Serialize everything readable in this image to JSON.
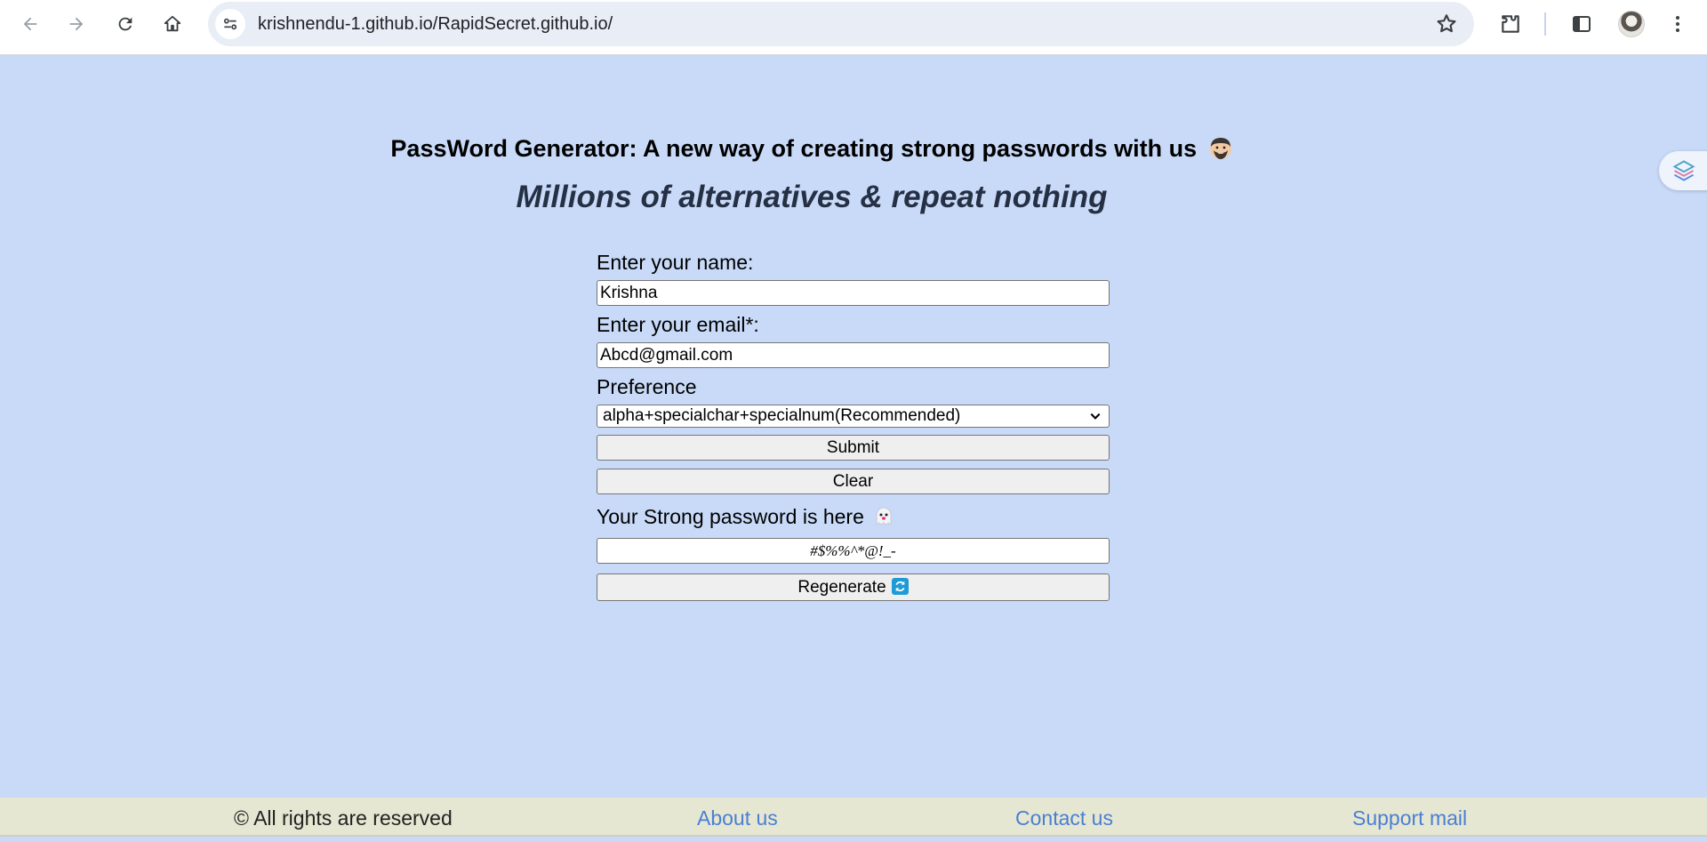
{
  "browser": {
    "url": "krishnendu-1.github.io/RapidSecret.github.io/"
  },
  "page": {
    "title": "PassWord Generator: A new way of creating strong passwords with us",
    "subtitle": "Millions of alternatives & repeat nothing"
  },
  "form": {
    "name_label": "Enter your name:",
    "name_value": "Krishna",
    "email_label": "Enter your email*:",
    "email_value": "Abcd@gmail.com",
    "preference_label": "Preference",
    "preference_selected": "alpha+specialchar+specialnum(Recommended)",
    "submit_label": "Submit",
    "clear_label": "Clear",
    "result_label": "Your Strong password is here",
    "password_value": "#$%%^*@!_-",
    "regenerate_label": "Regenerate"
  },
  "footer": {
    "copyright": "© All rights are reserved",
    "about": "About us",
    "contact": "Contact us",
    "support": "Support mail"
  },
  "icons": {
    "back": "back-arrow-icon",
    "forward": "forward-arrow-icon",
    "reload": "reload-icon",
    "home": "home-icon",
    "site_info": "site-settings-icon",
    "bookmark": "star-icon",
    "extensions": "puzzle-icon",
    "side_panel": "side-panel-icon",
    "menu": "kebab-menu-icon",
    "title_emoji": "man-face-emoji-icon",
    "ghost": "ghost-emoji-icon",
    "refresh": "refresh-icon"
  },
  "colors": {
    "page_background": "#c8daf8",
    "footer_background": "#e6e7d2",
    "link": "#4a7fd3",
    "subtitle": "#263044"
  }
}
